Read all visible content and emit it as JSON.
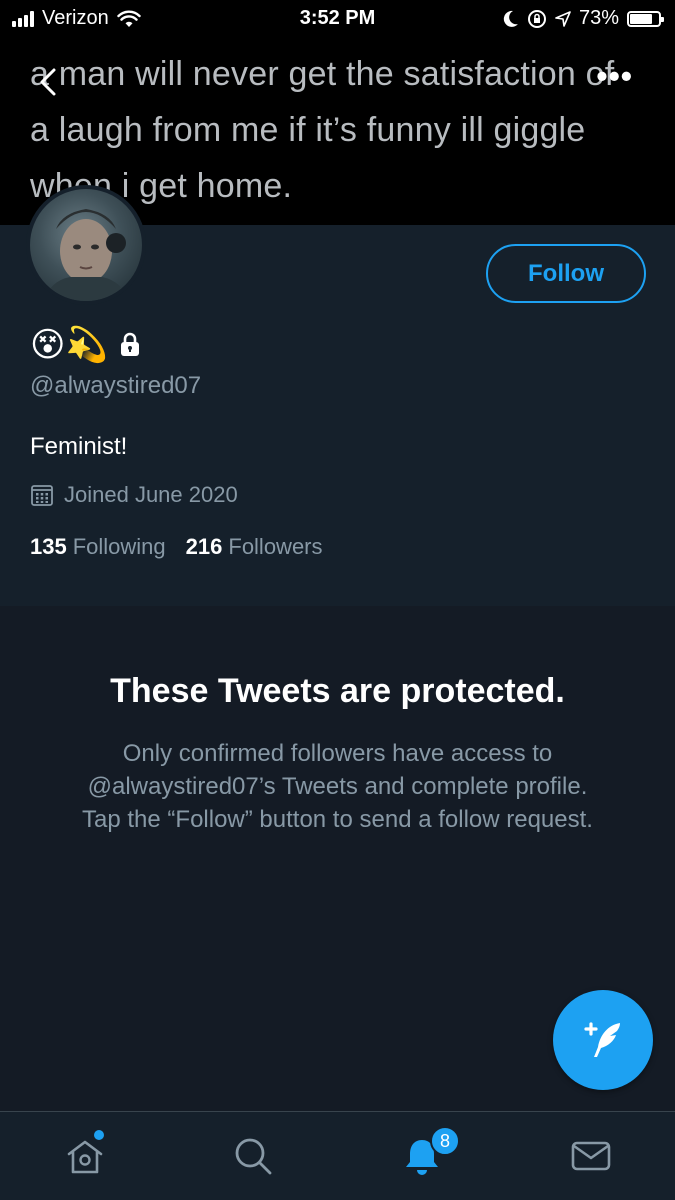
{
  "status_bar": {
    "carrier": "Verizon",
    "time": "3:52 PM",
    "battery": "73%",
    "battery_level": 0.73
  },
  "banner": {
    "text": "a man will never get the satisfaction of a laugh from me if it’s funny ill giggle when i get home."
  },
  "profile": {
    "name_emojis": "😵💫",
    "handle": "@alwaystired07",
    "bio": "Feminist!",
    "joined": "Joined June 2020",
    "following_count": "135",
    "following_label": "Following",
    "followers_count": "216",
    "followers_label": "Followers",
    "follow_button": "Follow"
  },
  "protected": {
    "title": "These Tweets are protected.",
    "description": "Only confirmed followers have access to @alwaystired07’s Tweets and complete profile. Tap the “Follow” button to send a follow request."
  },
  "tabbar": {
    "notifications_badge": "8",
    "icons": [
      "home-icon",
      "search-icon",
      "notifications-icon",
      "messages-icon"
    ]
  },
  "colors": {
    "accent": "#1da1f2",
    "background": "#15202b",
    "secondary_text": "#8899a6"
  }
}
